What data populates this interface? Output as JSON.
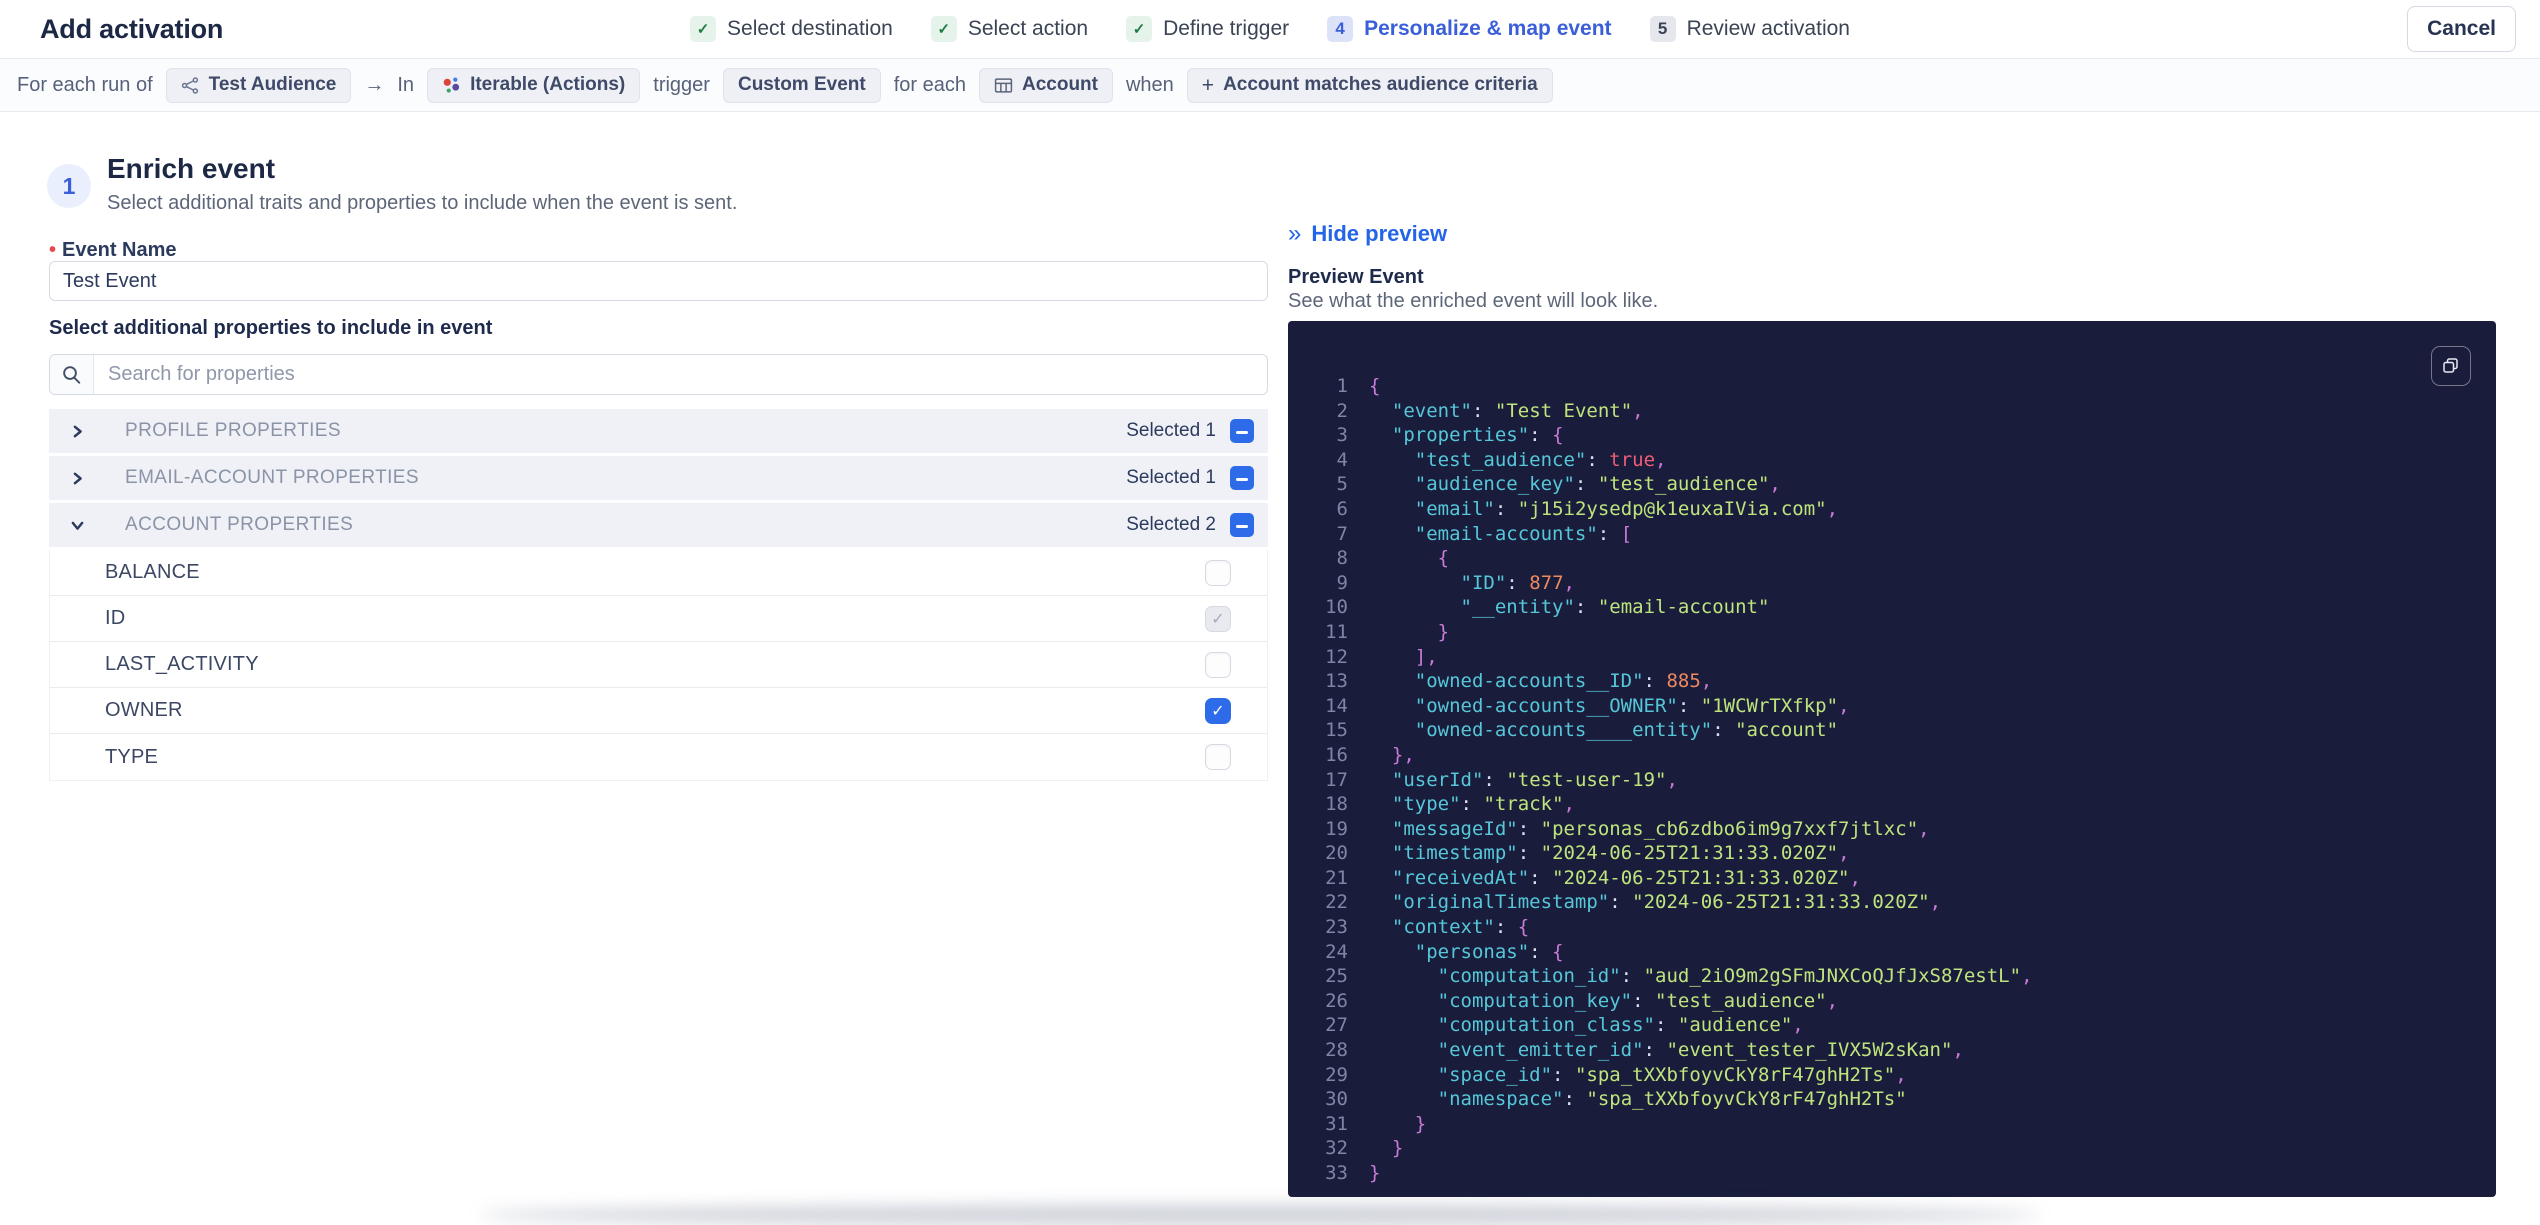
{
  "header": {
    "title": "Add activation",
    "cancel_label": "Cancel",
    "steps": [
      {
        "label": "Select destination",
        "state": "done"
      },
      {
        "label": "Select action",
        "state": "done"
      },
      {
        "label": "Define trigger",
        "state": "done"
      },
      {
        "label": "Personalize & map event",
        "state": "active",
        "number": "4"
      },
      {
        "label": "Review activation",
        "state": "upcoming",
        "number": "5"
      }
    ]
  },
  "trigger_bar": {
    "segments": [
      {
        "type": "text",
        "text": "For each run of"
      },
      {
        "type": "chip",
        "icon": "audience-icon",
        "label": "Test Audience"
      },
      {
        "type": "text",
        "text": "→"
      },
      {
        "type": "text",
        "text": "In"
      },
      {
        "type": "chip",
        "icon": "iterable-icon",
        "label": "Iterable (Actions)"
      },
      {
        "type": "text",
        "text": "trigger"
      },
      {
        "type": "chip",
        "label": "Custom Event"
      },
      {
        "type": "text",
        "text": "for each"
      },
      {
        "type": "chip",
        "icon": "table-icon",
        "label": "Account"
      },
      {
        "type": "text",
        "text": "when"
      },
      {
        "type": "chip",
        "icon": "plus-icon",
        "label": "Account matches audience criteria"
      }
    ]
  },
  "enrich": {
    "step_number": "1",
    "title": "Enrich event",
    "subtitle": "Select additional traits and properties to include when the event is sent.",
    "event_name": {
      "label": "Event Name",
      "value": "Test Event",
      "required": true
    },
    "select_properties_label": "Select additional properties to include in event",
    "search": {
      "placeholder": "Search for properties"
    },
    "groups": [
      {
        "name": "PROFILE PROPERTIES",
        "selected_label": "Selected 1",
        "expanded": false,
        "items": []
      },
      {
        "name": "EMAIL-ACCOUNT PROPERTIES",
        "selected_label": "Selected 1",
        "expanded": false,
        "items": []
      },
      {
        "name": "ACCOUNT PROPERTIES",
        "selected_label": "Selected 2",
        "expanded": true,
        "items": [
          {
            "label": "BALANCE",
            "state": "unchecked"
          },
          {
            "label": "ID",
            "state": "checked-muted"
          },
          {
            "label": "LAST_ACTIVITY",
            "state": "unchecked"
          },
          {
            "label": "OWNER",
            "state": "checked"
          },
          {
            "label": "TYPE",
            "state": "unchecked"
          }
        ]
      }
    ]
  },
  "preview": {
    "hide_label": "Hide preview",
    "title": "Preview Event",
    "subtitle": "See what the enriched event will look like.",
    "code_lines": [
      "{",
      "  \"event\": \"Test Event\",",
      "  \"properties\": {",
      "    \"test_audience\": true,",
      "    \"audience_key\": \"test_audience\",",
      "    \"email\": \"j15i2ysedp@k1euxaIVia.com\",",
      "    \"email-accounts\": [",
      "      {",
      "        \"ID\": 877,",
      "        \"__entity\": \"email-account\"",
      "      }",
      "    ],",
      "    \"owned-accounts__ID\": 885,",
      "    \"owned-accounts__OWNER\": \"1WCWrTXfkp\",",
      "    \"owned-accounts____entity\": \"account\"",
      "  },",
      "  \"userId\": \"test-user-19\",",
      "  \"type\": \"track\",",
      "  \"messageId\": \"personas_cb6zdbo6im9g7xxf7jtlxc\",",
      "  \"timestamp\": \"2024-06-25T21:31:33.020Z\",",
      "  \"receivedAt\": \"2024-06-25T21:31:33.020Z\",",
      "  \"originalTimestamp\": \"2024-06-25T21:31:33.020Z\",",
      "  \"context\": {",
      "    \"personas\": {",
      "      \"computation_id\": \"aud_2iO9m2gSFmJNXCoQJfJxS87estL\",",
      "      \"computation_key\": \"test_audience\",",
      "      \"computation_class\": \"audience\",",
      "      \"event_emitter_id\": \"event_tester_IVX5W2sKan\",",
      "      \"space_id\": \"spa_tXXbfoyvCkY8rF47ghH2Ts\",",
      "      \"namespace\": \"spa_tXXbfoyvCkY8rF47ghH2Ts\"",
      "    }",
      "  }",
      "}"
    ]
  },
  "colors": {
    "accent_blue": "#2e6be8",
    "link_blue": "#2465e8",
    "active_step_blue": "#3a5fd9",
    "success_green": "#1e7e45",
    "required_red": "#e5484d",
    "code_bg": "#191d3b",
    "code_key": "#56c7da",
    "code_string": "#bfe47e",
    "code_number": "#ee8a5f",
    "code_boolean": "#ef5d78",
    "code_punct": "#c97bd8"
  }
}
